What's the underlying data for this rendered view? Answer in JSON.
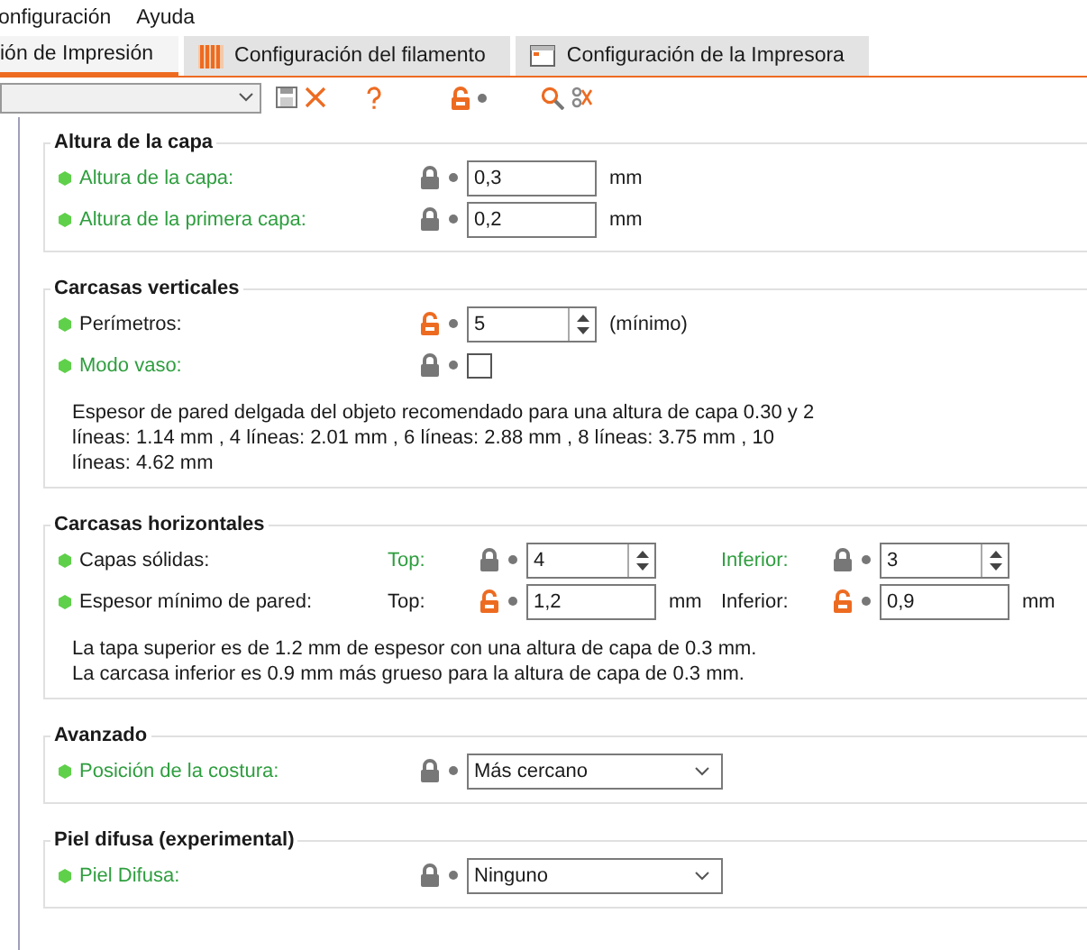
{
  "menu": [
    "onfiguración",
    "Ayuda"
  ],
  "tabs": [
    {
      "label": "ión de Impresión",
      "kind": "plain",
      "selected": true
    },
    {
      "label": "Configuración del filamento",
      "kind": "filament",
      "selected": false
    },
    {
      "label": "Configuración de la Impresora",
      "kind": "printer",
      "selected": false
    }
  ],
  "toolbar": {
    "lock_open": true
  },
  "groups": [
    {
      "title": "Altura de la capa",
      "rows": [
        {
          "label": "Altura de la capa:",
          "system_value": true,
          "fields": [
            {
              "kind": "text",
              "locked": true,
              "value": "0,3",
              "unit": "mm"
            }
          ]
        },
        {
          "label": "Altura de la primera capa:",
          "system_value": true,
          "fields": [
            {
              "kind": "text",
              "locked": true,
              "value": "0,2",
              "unit": "mm"
            }
          ]
        }
      ]
    },
    {
      "title": "Carcasas verticales",
      "rows": [
        {
          "label": "Perímetros:",
          "system_value": false,
          "fields": [
            {
              "kind": "spin",
              "locked": false,
              "value": "5",
              "unit": "(mínimo)"
            }
          ]
        },
        {
          "label": "Modo vaso:",
          "system_value": true,
          "fields": [
            {
              "kind": "checkbox",
              "locked": true,
              "checked": false
            }
          ]
        }
      ],
      "notes": [
        "Espesor de pared delgada del objeto recomendado para una altura de capa 0.30 y 2 líneas: 1.14 mm , 4 líneas: 2.01 mm , 6 líneas: 2.88 mm , 8 líneas: 3.75 mm , 10 líneas: 4.62 mm"
      ]
    },
    {
      "title": "Carcasas horizontales",
      "rows": [
        {
          "label": "Capas sólidas:",
          "system_value": false,
          "fields": [
            {
              "kind": "spin",
              "sublabel": "Top:",
              "system_value": true,
              "locked": true,
              "value": "4"
            },
            {
              "kind": "spin",
              "sublabel": "Inferior:",
              "system_value": true,
              "locked": true,
              "value": "3"
            }
          ]
        },
        {
          "label": "Espesor mínimo de pared:",
          "system_value": false,
          "fields": [
            {
              "kind": "text",
              "sublabel": "Top:",
              "system_value": false,
              "locked": false,
              "value": "1,2",
              "unit": "mm"
            },
            {
              "kind": "text",
              "sublabel": "Inferior:",
              "system_value": false,
              "locked": false,
              "value": "0,9",
              "unit": "mm"
            }
          ]
        }
      ],
      "notes": [
        "La tapa superior es de 1.2 mm de espesor con una altura de capa de 0.3 mm.",
        "La carcasa inferior es 0.9 mm más grueso para la altura de capa de 0.3 mm."
      ]
    },
    {
      "title": "Avanzado",
      "rows": [
        {
          "label": "Posición de la costura:",
          "system_value": true,
          "fields": [
            {
              "kind": "select",
              "locked": true,
              "value": "Más cercano"
            }
          ]
        }
      ]
    },
    {
      "title": "Piel difusa (experimental)",
      "rows": [
        {
          "label": "Piel Difusa:",
          "system_value": true,
          "fields": [
            {
              "kind": "select",
              "locked": true,
              "value": "Ninguno"
            }
          ]
        }
      ]
    }
  ]
}
